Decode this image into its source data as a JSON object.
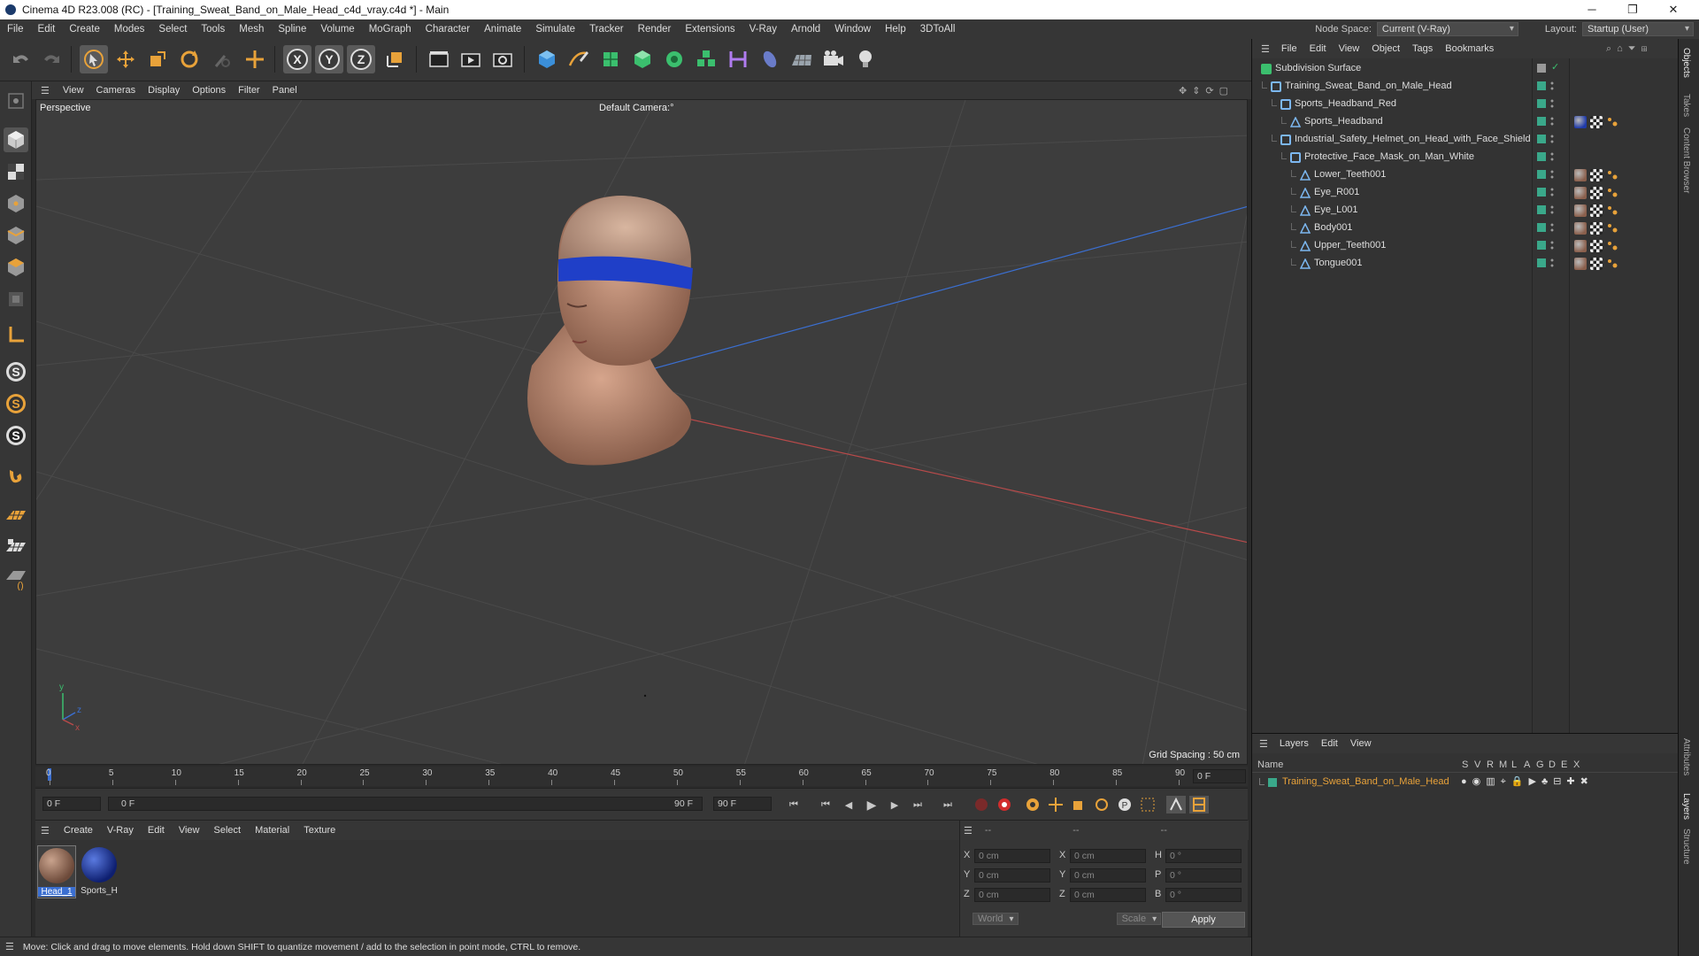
{
  "window": {
    "title": "Cinema 4D R23.008 (RC) - [Training_Sweat_Band_on_Male_Head_c4d_vray.c4d *] - Main",
    "minimize": "─",
    "maximize": "❐",
    "close": "✕"
  },
  "menubar": {
    "items": [
      "File",
      "Edit",
      "Create",
      "Modes",
      "Select",
      "Tools",
      "Mesh",
      "Spline",
      "Volume",
      "MoGraph",
      "Character",
      "Animate",
      "Simulate",
      "Tracker",
      "Render",
      "Extensions",
      "V-Ray",
      "Arnold",
      "Window",
      "Help",
      "3DToAll"
    ],
    "node_space_label": "Node Space:",
    "node_space_value": "Current (V-Ray)",
    "layout_label": "Layout:",
    "layout_value": "Startup (User)"
  },
  "viewport": {
    "menu": [
      "View",
      "Cameras",
      "Display",
      "Options",
      "Filter",
      "Panel"
    ],
    "projection": "Perspective",
    "camera": "Default Camera",
    "camera_suffix": ":°",
    "grid_spacing": "Grid Spacing : 50 cm",
    "axis_y": "y",
    "axis_z": "z",
    "axis_x": "x"
  },
  "timeline": {
    "ticks": [
      "0",
      "5",
      "10",
      "15",
      "20",
      "25",
      "30",
      "35",
      "40",
      "45",
      "50",
      "55",
      "60",
      "65",
      "70",
      "75",
      "80",
      "85",
      "90"
    ],
    "current_frame": "0 F",
    "start_field": "0 F",
    "range_start": "0 F",
    "range_end": "90 F",
    "end_field": "90 F"
  },
  "materials": {
    "menu": [
      "Create",
      "V-Ray",
      "Edit",
      "View",
      "Select",
      "Material",
      "Texture"
    ],
    "items": [
      {
        "label": "Head_1",
        "color": "#8a6a55"
      },
      {
        "label": "Sports_H",
        "color": "#1f3a9a"
      }
    ]
  },
  "coordinates": {
    "header": [
      "--",
      "--",
      "--"
    ],
    "rows": [
      {
        "a": "X",
        "av": "0 cm",
        "b": "X",
        "bv": "0 cm",
        "c": "H",
        "cv": "0 °"
      },
      {
        "a": "Y",
        "av": "0 cm",
        "b": "Y",
        "bv": "0 cm",
        "c": "P",
        "cv": "0 °"
      },
      {
        "a": "Z",
        "av": "0 cm",
        "b": "Z",
        "bv": "0 cm",
        "c": "B",
        "cv": "0 °"
      }
    ],
    "world": "World",
    "scale": "Scale",
    "apply": "Apply"
  },
  "status": {
    "text": "Move: Click and drag to move elements. Hold down SHIFT to quantize movement / add to the selection in point mode, CTRL to remove."
  },
  "objects": {
    "menu": [
      "File",
      "Edit",
      "View",
      "Object",
      "Tags",
      "Bookmarks"
    ],
    "rows": [
      {
        "name": "Subdivision Surface",
        "indent": 0,
        "icon": "subdivision-icon",
        "tags": []
      },
      {
        "name": "Training_Sweat_Band_on_Male_Head",
        "indent": 1,
        "icon": "null-icon",
        "tags": []
      },
      {
        "name": "Sports_Headband_Red",
        "indent": 2,
        "icon": "null-icon",
        "tags": []
      },
      {
        "name": "Sports_Headband",
        "indent": 3,
        "icon": "polygon-icon",
        "tags": [
          "blue",
          "checker",
          "dots"
        ]
      },
      {
        "name": "Industrial_Safety_Helmet_on_Head_with_Face_Shield",
        "indent": 2,
        "icon": "null-icon",
        "tags": []
      },
      {
        "name": "Protective_Face_Mask_on_Man_White",
        "indent": 3,
        "icon": "null-icon",
        "tags": []
      },
      {
        "name": "Lower_Teeth001",
        "indent": 4,
        "icon": "polygon-icon",
        "tags": [
          "skin",
          "checker",
          "dots"
        ]
      },
      {
        "name": "Eye_R001",
        "indent": 4,
        "icon": "polygon-icon",
        "tags": [
          "skin",
          "checker",
          "dots"
        ]
      },
      {
        "name": "Eye_L001",
        "indent": 4,
        "icon": "polygon-icon",
        "tags": [
          "skin",
          "checker",
          "dots"
        ]
      },
      {
        "name": "Body001",
        "indent": 4,
        "icon": "polygon-icon",
        "tags": [
          "skin",
          "checker",
          "dots"
        ]
      },
      {
        "name": "Upper_Teeth001",
        "indent": 4,
        "icon": "polygon-icon",
        "tags": [
          "skin",
          "checker",
          "dots"
        ]
      },
      {
        "name": "Tongue001",
        "indent": 4,
        "icon": "polygon-icon",
        "tags": [
          "skin",
          "checker",
          "dots"
        ]
      }
    ]
  },
  "layers": {
    "menu": [
      "Layers",
      "Edit",
      "View"
    ],
    "name_header": "Name",
    "col_headers": [
      "S",
      "V",
      "R",
      "M",
      "L",
      "A",
      "G",
      "D",
      "E",
      "X"
    ],
    "rows": [
      {
        "name": "Training_Sweat_Band_on_Male_Head",
        "color": "#3aa88a"
      }
    ]
  },
  "side_tabs": [
    "Objects",
    "Takes",
    "Content Browser",
    "Attributes",
    "Layers",
    "Structure"
  ],
  "colors": {
    "accent": "#e8a23a",
    "layer_text": "#e8a23a",
    "visible_tag": "#3aa88a",
    "headband": "#1f3fc8"
  }
}
